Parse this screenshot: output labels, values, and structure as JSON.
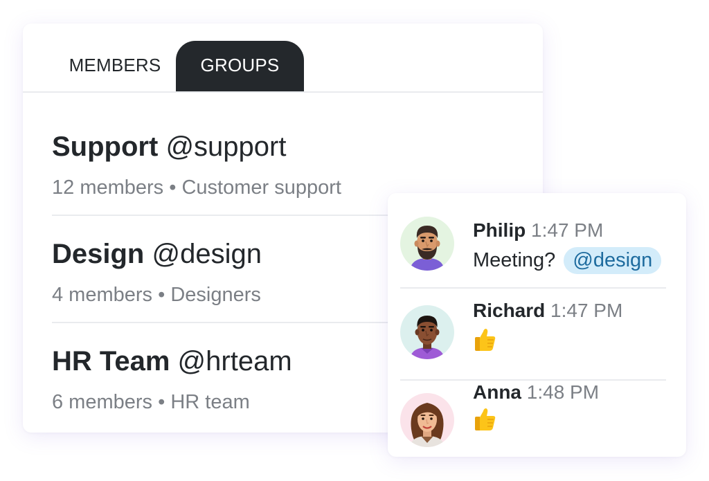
{
  "tabs": {
    "members": "MEMBERS",
    "groups": "GROUPS",
    "active": "GROUPS",
    "active_color": "#24282c"
  },
  "groups": [
    {
      "name": "Support",
      "handle": "@support",
      "members": "12 members",
      "separator": "•",
      "description": "Customer support"
    },
    {
      "name": "Design",
      "handle": "@design",
      "members": "4 members",
      "separator": "•",
      "description": "Designers"
    },
    {
      "name": "HR Team",
      "handle": "@hrteam",
      "members": "6 members",
      "separator": "•",
      "description": "HR team"
    }
  ],
  "messages": [
    {
      "author": "Philip",
      "time": "1:47 PM",
      "text": "Meeting?",
      "mention": "@design",
      "avatar": "philip-avatar-icon"
    },
    {
      "author": "Richard",
      "time": "1:47 PM",
      "reaction": "thumbs-up-icon",
      "avatar": "richard-avatar-icon"
    },
    {
      "author": "Anna",
      "time": "1:48 PM",
      "reaction": "thumbs-up-icon",
      "avatar": "anna-avatar-icon"
    }
  ],
  "colors": {
    "mention_bg": "#d3ecfa",
    "mention_text": "#1d6b9e",
    "muted_text": "#7b7f85",
    "divider": "#e9ebee"
  }
}
